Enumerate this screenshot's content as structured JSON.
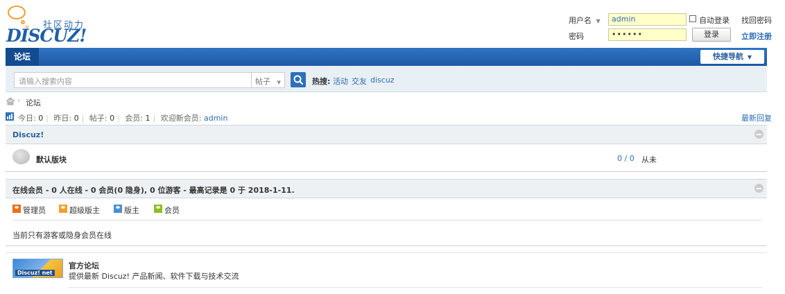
{
  "logo": {
    "tagline": "社区动力",
    "wordmark": "DISCUZ!"
  },
  "login": {
    "username_label": "用户名",
    "username_value": "admin",
    "password_label": "密码",
    "password_value": "••••••",
    "auto_login_label": "自动登录",
    "login_button": "登录",
    "forgot_password": "找回密码",
    "register": "立即注册"
  },
  "nav": {
    "tab_forum": "论坛",
    "quick_nav": "快捷导航"
  },
  "search": {
    "placeholder": "请输入搜索内容",
    "type_selected": "帖子",
    "hot_label": "热搜:",
    "hot_terms": [
      "活动",
      "交友",
      "discuz"
    ]
  },
  "breadcrumb": {
    "current": "论坛"
  },
  "stats": {
    "today_label": "今日:",
    "today": "0",
    "yesterday_label": "昨日:",
    "yesterday": "0",
    "posts_label": "帖子:",
    "posts": "0",
    "members_label": "会员:",
    "members": "1",
    "welcome_label": "欢迎新会员:",
    "newest_member": "admin",
    "latest_replies": "最新回复"
  },
  "category": {
    "title": "Discuz!",
    "forums": [
      {
        "name": "默认版块",
        "counts": "0 / 0",
        "last_post": "从未"
      }
    ]
  },
  "online": {
    "title": "在线会员 - 0 人在线 - 0 会员(0 隐身), 0 位游客 - 最高记录是 0 于 2018-1-11.",
    "legend": [
      {
        "label": "管理员",
        "color": "#e8701a"
      },
      {
        "label": "超级版主",
        "color": "#f0a030"
      },
      {
        "label": "版主",
        "color": "#4a90d0"
      },
      {
        "label": "会员",
        "color": "#8cbf26"
      }
    ],
    "message": "当前只有游客或隐身会员在线"
  },
  "links": {
    "image_text": "Discuz! net",
    "title": "官方论坛",
    "description": "提供最新 Discuz! 产品新闻、软件下载与技术交流"
  }
}
